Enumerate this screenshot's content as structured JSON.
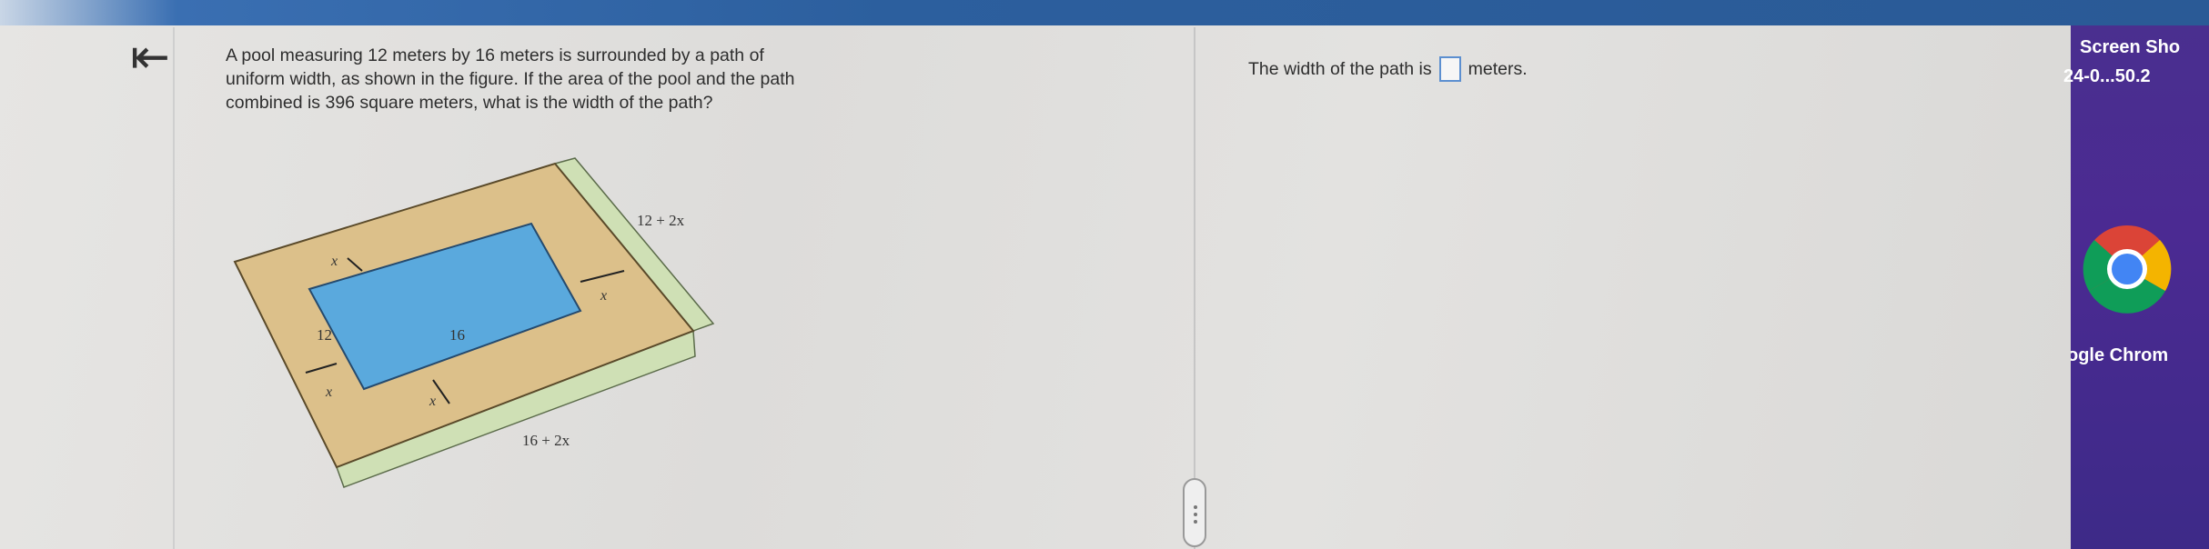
{
  "question": {
    "line1": "A pool measuring 12 meters by 16 meters is surrounded by a path of",
    "line2": "uniform width, as shown in the figure.  If the area of the pool and the path",
    "line3": "combined is 396 square meters, what is the width of the path?"
  },
  "answer": {
    "prefix": "The width of the path is",
    "suffix": "meters."
  },
  "figure": {
    "pool_width": "12",
    "pool_length": "16",
    "outer_width": "12 + 2x",
    "outer_length": "16 + 2x",
    "path_label": "x",
    "colors": {
      "path": "#dcc08a",
      "pool": "#5aa9dd",
      "dimension_bar": "#cfe0b5"
    }
  },
  "dock": {
    "item1_line1": "Screen Sho",
    "item1_line2": "24-0...50.2",
    "chrome_label": "ogle Chrom"
  },
  "icons": {
    "back": "back-arrow-icon",
    "chrome": "chrome-icon"
  }
}
